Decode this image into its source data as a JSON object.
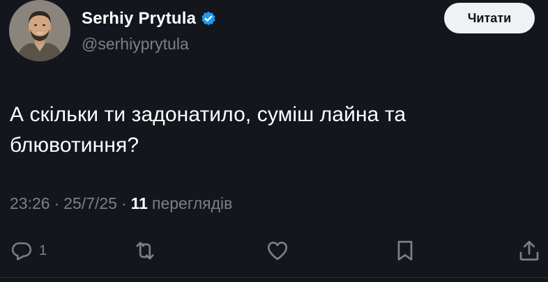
{
  "author": {
    "name": "Serhiy Prytula",
    "handle": "@serhiyprytula",
    "verified_color": "#1d9bf0"
  },
  "follow_button": {
    "label": "Читати"
  },
  "tweet": {
    "text_line_1": "А скільки ти задонатило, суміш лайна та",
    "text_line_2": "блювотиння?"
  },
  "meta": {
    "time": "23:26",
    "separator": "·",
    "date": "25/7/25",
    "views_count": "11",
    "views_label": "переглядів"
  },
  "actions": {
    "reply": {
      "icon": "reply-icon",
      "count": "1"
    },
    "retweet": {
      "icon": "retweet-icon"
    },
    "like": {
      "icon": "heart-icon"
    },
    "bookmark": {
      "icon": "bookmark-icon"
    },
    "share": {
      "icon": "share-icon"
    }
  },
  "colors": {
    "background": "#14161d",
    "text": "#ffffff",
    "secondary_text": "#7b8088",
    "button_bg": "#eff1f4",
    "button_text": "#0f1419"
  }
}
